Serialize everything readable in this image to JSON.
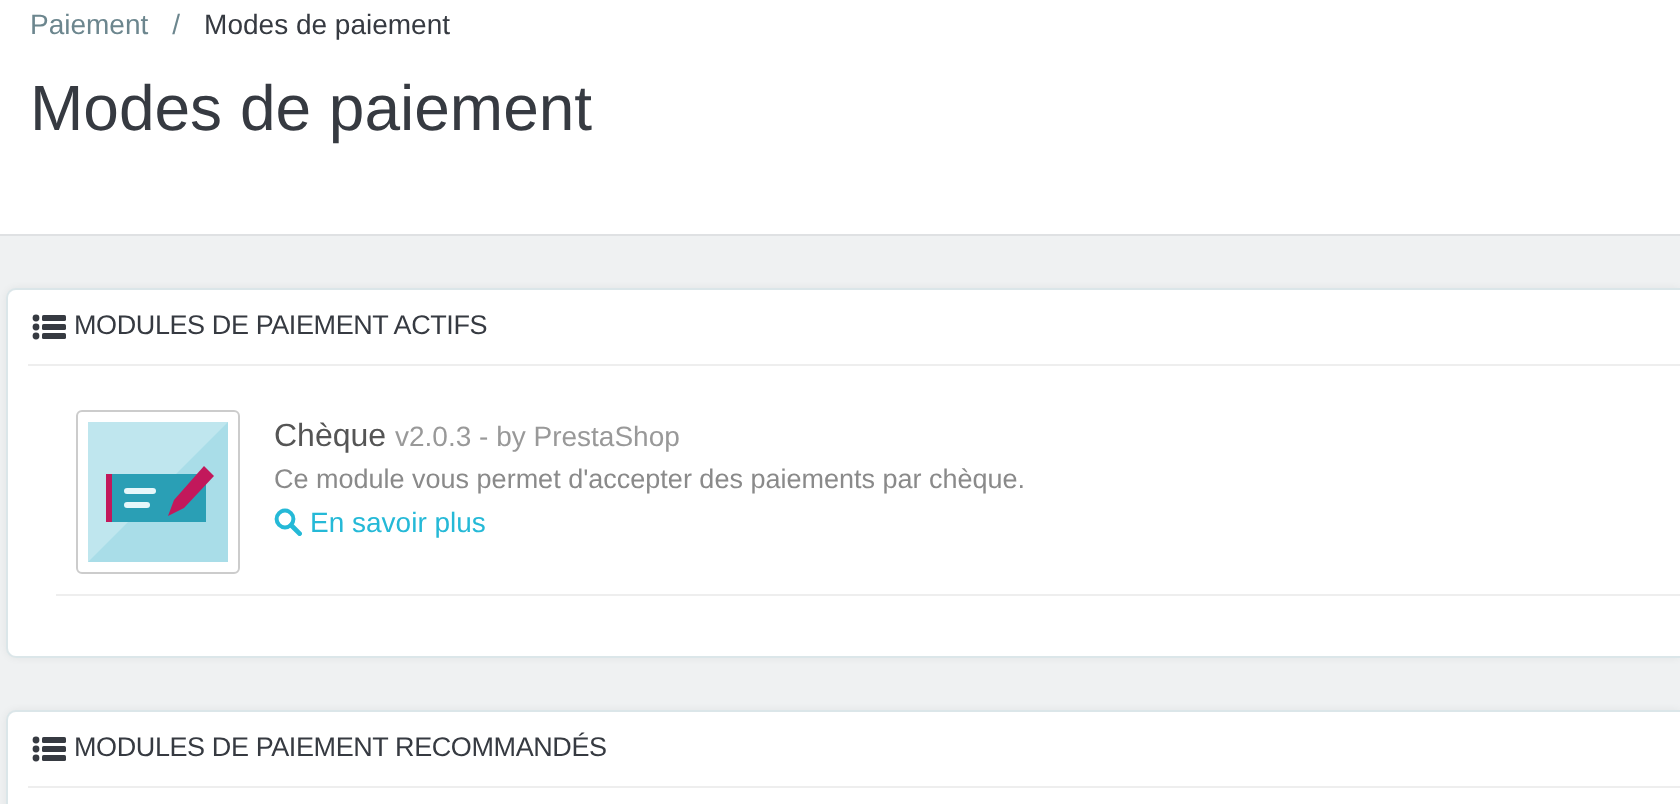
{
  "breadcrumb": {
    "items": [
      "Paiement",
      "Modes de paiement"
    ],
    "separator": "/"
  },
  "title": "Modes de paiement",
  "panels": [
    {
      "heading": "MODULES DE PAIEMENT ACTIFS",
      "modules": [
        {
          "name": "Chèque",
          "meta": "v2.0.3 - by PrestaShop",
          "description": "Ce module vous permet d'accepter des paiements par chèque.",
          "link": "En savoir plus"
        }
      ]
    },
    {
      "heading": "MODULES DE PAIEMENT RECOMMANDÉS"
    }
  ]
}
